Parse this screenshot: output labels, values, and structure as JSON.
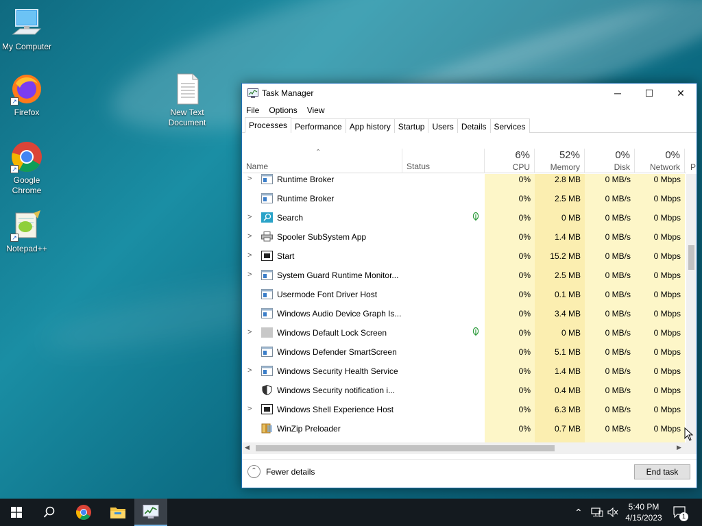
{
  "desktop": {
    "icons": [
      {
        "label": "My Computer",
        "icon": "computer-icon"
      },
      {
        "label": "Firefox",
        "icon": "firefox-icon"
      },
      {
        "label": "Google Chrome",
        "icon": "chrome-icon"
      },
      {
        "label": "Notepad++",
        "icon": "notepad-plus-plus-icon"
      },
      {
        "label": "New Text Document",
        "icon": "text-document-icon"
      }
    ]
  },
  "window": {
    "title": "Task Manager",
    "controls": {
      "minimize": "─",
      "maximize": "☐",
      "close": "✕"
    },
    "menu": [
      "File",
      "Options",
      "View"
    ],
    "tabs": [
      "Processes",
      "Performance",
      "App history",
      "Startup",
      "Users",
      "Details",
      "Services"
    ],
    "active_tab": "Processes",
    "columns": {
      "name": "Name",
      "status": "Status",
      "cpu": {
        "pct": "6%",
        "label": "CPU"
      },
      "memory": {
        "pct": "52%",
        "label": "Memory"
      },
      "disk": {
        "pct": "0%",
        "label": "Disk"
      },
      "network": {
        "pct": "0%",
        "label": "Network"
      },
      "power": "P"
    },
    "processes": [
      {
        "name": "Runtime Broker",
        "expand": true,
        "icon": "app-window-icon",
        "leaf": false,
        "cpu": "0%",
        "memory": "2.8 MB",
        "disk": "0 MB/s",
        "network": "0 Mbps"
      },
      {
        "name": "Runtime Broker",
        "expand": false,
        "icon": "app-window-icon",
        "leaf": false,
        "cpu": "0%",
        "memory": "2.5 MB",
        "disk": "0 MB/s",
        "network": "0 Mbps"
      },
      {
        "name": "Search",
        "expand": true,
        "icon": "search-app-icon",
        "leaf": true,
        "cpu": "0%",
        "memory": "0 MB",
        "disk": "0 MB/s",
        "network": "0 Mbps"
      },
      {
        "name": "Spooler SubSystem App",
        "expand": true,
        "icon": "printer-icon",
        "leaf": false,
        "cpu": "0%",
        "memory": "1.4 MB",
        "disk": "0 MB/s",
        "network": "0 Mbps"
      },
      {
        "name": "Start",
        "expand": true,
        "icon": "start-app-icon",
        "leaf": false,
        "cpu": "0%",
        "memory": "15.2 MB",
        "disk": "0 MB/s",
        "network": "0 Mbps"
      },
      {
        "name": "System Guard Runtime Monitor...",
        "expand": true,
        "icon": "app-window-icon",
        "leaf": false,
        "cpu": "0%",
        "memory": "2.5 MB",
        "disk": "0 MB/s",
        "network": "0 Mbps"
      },
      {
        "name": "Usermode Font Driver Host",
        "expand": false,
        "icon": "app-window-icon",
        "leaf": false,
        "cpu": "0%",
        "memory": "0.1 MB",
        "disk": "0 MB/s",
        "network": "0 Mbps"
      },
      {
        "name": "Windows Audio Device Graph Is...",
        "expand": false,
        "icon": "app-window-icon",
        "leaf": false,
        "cpu": "0%",
        "memory": "3.4 MB",
        "disk": "0 MB/s",
        "network": "0 Mbps"
      },
      {
        "name": "Windows Default Lock Screen",
        "expand": true,
        "icon": "lock-screen-icon",
        "leaf": true,
        "cpu": "0%",
        "memory": "0 MB",
        "disk": "0 MB/s",
        "network": "0 Mbps"
      },
      {
        "name": "Windows Defender SmartScreen",
        "expand": false,
        "icon": "app-window-icon",
        "leaf": false,
        "cpu": "0%",
        "memory": "5.1 MB",
        "disk": "0 MB/s",
        "network": "0 Mbps"
      },
      {
        "name": "Windows Security Health Service",
        "expand": true,
        "icon": "app-window-icon",
        "leaf": false,
        "cpu": "0%",
        "memory": "1.4 MB",
        "disk": "0 MB/s",
        "network": "0 Mbps"
      },
      {
        "name": "Windows Security notification i...",
        "expand": false,
        "icon": "shield-icon",
        "leaf": false,
        "cpu": "0%",
        "memory": "0.4 MB",
        "disk": "0 MB/s",
        "network": "0 Mbps"
      },
      {
        "name": "Windows Shell Experience Host",
        "expand": true,
        "icon": "start-app-icon",
        "leaf": false,
        "cpu": "0%",
        "memory": "6.3 MB",
        "disk": "0 MB/s",
        "network": "0 Mbps"
      },
      {
        "name": "WinZip Preloader",
        "expand": false,
        "icon": "winzip-icon",
        "leaf": false,
        "cpu": "0%",
        "memory": "0.7 MB",
        "disk": "0 MB/s",
        "network": "0 Mbps"
      }
    ],
    "footer": {
      "fewer_details": "Fewer details",
      "end_task": "End task"
    }
  },
  "taskbar": {
    "clock_time": "5:40 PM",
    "clock_date": "4/15/2023",
    "notification_count": "1"
  }
}
